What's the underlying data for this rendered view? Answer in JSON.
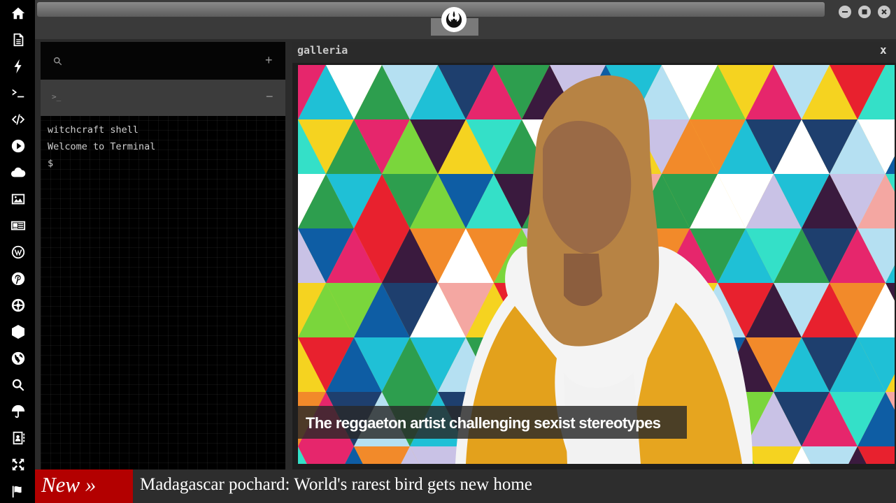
{
  "sidebar": {
    "icons": [
      "home-icon",
      "document-icon",
      "bolt-icon",
      "terminal-icon",
      "code-icon",
      "play-icon",
      "cloud-icon",
      "image-icon",
      "newspaper-icon",
      "wordpress-icon",
      "pinterest-icon",
      "galactic-empire-icon",
      "geometry-icon",
      "globe-icon",
      "search-icon",
      "umbrella-icon",
      "contacts-icon",
      "fullscreen-icon",
      "flag-icon"
    ]
  },
  "topbar": {
    "logo": "rebel-alliance-icon"
  },
  "terminal": {
    "tab_prompt": ">_",
    "add_symbol": "+",
    "collapse_symbol": "−",
    "lines": [
      "witchcraft shell",
      "Welcome to Terminal",
      "$"
    ]
  },
  "gallery": {
    "title": "galleria",
    "close": "x",
    "caption": "The reggaeton artist challenging sexist stereotypes"
  },
  "ticker": {
    "label": "New »",
    "headline": "Madagascar pochard: World's rarest bird gets new home"
  },
  "colors": {
    "ticker_label": "#b30000",
    "sidebar": "#000000",
    "terminal": "#000000"
  }
}
